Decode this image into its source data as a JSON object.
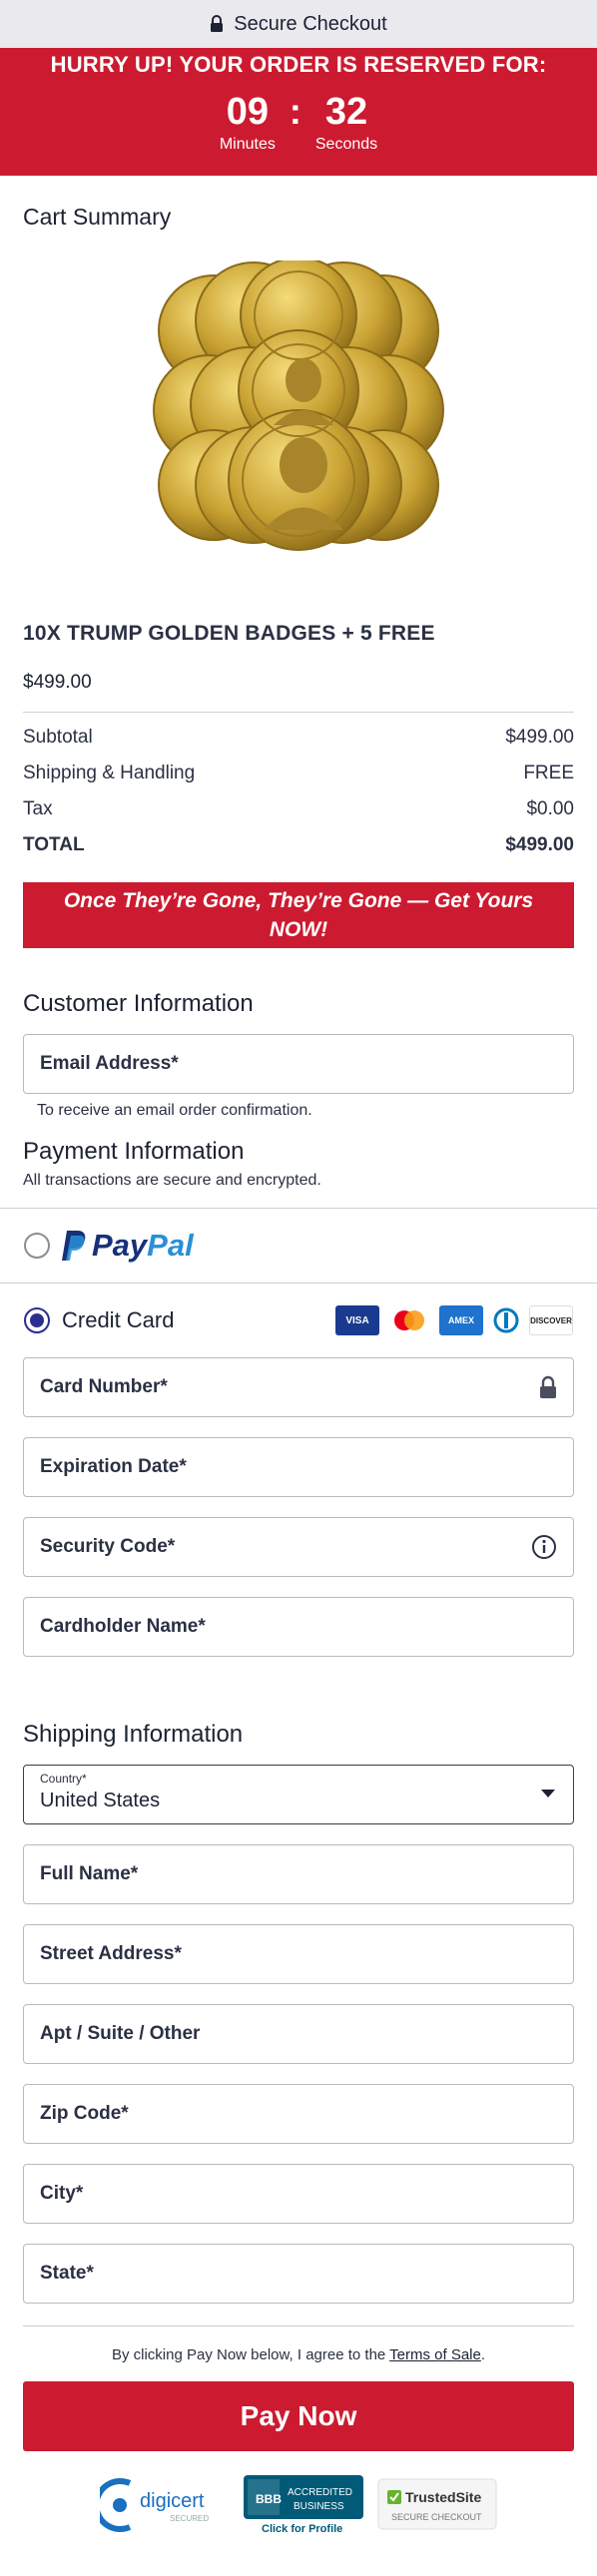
{
  "header": {
    "title": "Secure Checkout"
  },
  "banner": {
    "headline": "HURRY UP! YOUR ORDER IS RESERVED FOR:",
    "minutes": "09",
    "separator": ":",
    "seconds": "32",
    "minutes_label": "Minutes",
    "seconds_label": "Seconds"
  },
  "cart": {
    "title": "Cart Summary",
    "product_name": "10X TRUMP GOLDEN BADGES + 5 FREE",
    "product_price": "$499.00",
    "rows": [
      {
        "label": "Subtotal",
        "value": "$499.00"
      },
      {
        "label": "Shipping & Handling",
        "value": "FREE"
      },
      {
        "label": "Tax",
        "value": "$0.00"
      },
      {
        "label": "TOTAL",
        "value": "$499.00"
      }
    ],
    "urgency": "Once They’re Gone, They’re Gone — Get Yours NOW!"
  },
  "customer": {
    "title": "Customer Information",
    "email_placeholder": "Email Address*",
    "email_hint": "To receive an email order confirmation."
  },
  "payment": {
    "title": "Payment Information",
    "subtitle": "All transactions are secure and encrypted.",
    "paypal_a": "Pay",
    "paypal_b": "Pal",
    "credit_card_label": "Credit Card",
    "cards": [
      "VISA",
      "MC",
      "AMEX",
      "DINERS",
      "DISCOVER"
    ],
    "card_number": "Card Number*",
    "expiration": "Expiration Date*",
    "security_code": "Security Code*",
    "cardholder": "Cardholder Name*"
  },
  "shipping": {
    "title": "Shipping Information",
    "country_label": "Country*",
    "country_value": "United States",
    "full_name": "Full Name*",
    "street": "Street Address*",
    "apt": "Apt / Suite / Other",
    "zip": "Zip Code*",
    "city": "City*",
    "state": "State*"
  },
  "footer": {
    "terms_prefix": "By clicking Pay Now below, I agree to the ",
    "terms_link": "Terms of Sale",
    "terms_suffix": ".",
    "pay_button": "Pay Now",
    "digicert": "digicert",
    "digicert_sub": "SECURED",
    "bbb_line1": "ACCREDITED",
    "bbb_line2": "BUSINESS",
    "bbb_sub": "Click for Profile",
    "trustedsite": "TrustedSite",
    "trustedsite_sub": "SECURE CHECKOUT"
  },
  "colors": {
    "brand_red": "#cc1b30",
    "radio_selected": "#2b2f8f",
    "gold": "#c9a233"
  }
}
